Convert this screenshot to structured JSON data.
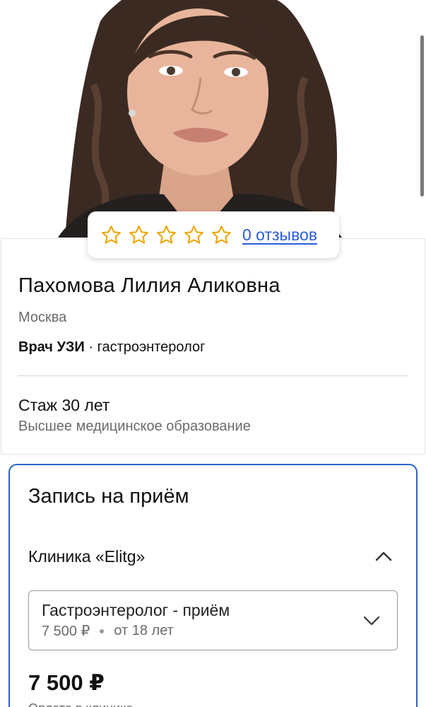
{
  "doctor": {
    "photo_icon": "doctor-portrait-photo",
    "name": "Пахомова Лилия Аликовна",
    "city": "Москва",
    "specialty_primary": "Врач УЗИ",
    "specialty_secondary": " · гастроэнтеролог",
    "experience": "Стаж 30 лет",
    "education": "Высшее медицинское образование"
  },
  "rating": {
    "stars_total": 5,
    "stars_filled": 0,
    "star_color": "#f0a400",
    "reviews_label": "0 отзывов"
  },
  "booking": {
    "title": "Запись на приём",
    "clinic": "Клиника «Elitg»",
    "clinic_expanded": true,
    "service": {
      "name": "Гастроэнтеролог - приём",
      "price": "7 500 ₽",
      "age": "от 18 лет"
    },
    "total_price": "7 500 ₽",
    "payment_note": "Оплата в клинике"
  },
  "colors": {
    "accent": "#2a64c8",
    "link": "#2a5bd7",
    "secondary_text": "#6b6b6b"
  }
}
